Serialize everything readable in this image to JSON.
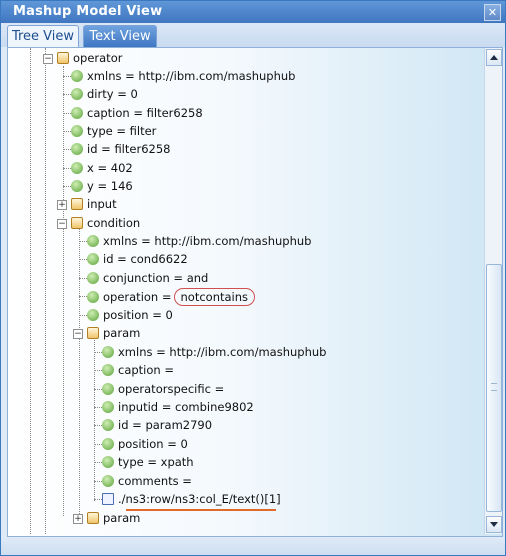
{
  "window": {
    "title": "Mashup Model View",
    "close_glyph": "✕"
  },
  "tabs": [
    {
      "label": "Tree View",
      "active": true
    },
    {
      "label": "Text View",
      "active": false
    }
  ],
  "tree": {
    "operator": {
      "label": "operator",
      "expander": "−"
    },
    "operator_attrs": [
      "xmlns = http://ibm.com/mashuphub",
      "dirty = 0",
      "caption = filter6258",
      "type = filter",
      "id = filter6258",
      "x = 402",
      "y = 146"
    ],
    "input": {
      "label": "input",
      "expander": "+"
    },
    "condition": {
      "label": "condition",
      "expander": "−"
    },
    "condition_attrs": [
      "xmlns = http://ibm.com/mashuphub",
      "id = cond6622",
      "conjunction = and"
    ],
    "operation": {
      "label": "operation =",
      "value": "notcontains"
    },
    "position": "position = 0",
    "param": {
      "label": "param",
      "expander": "−"
    },
    "param_attrs": [
      "xmlns = http://ibm.com/mashuphub",
      "caption =",
      "operatorspecific =",
      "inputid = combine9802",
      "id = param2790",
      "position = 0",
      "type = xpath",
      "comments ="
    ],
    "text_node": "./ns3:row/ns3:col_E/text()[1]",
    "param2": {
      "label": "param",
      "expander": "+"
    }
  }
}
